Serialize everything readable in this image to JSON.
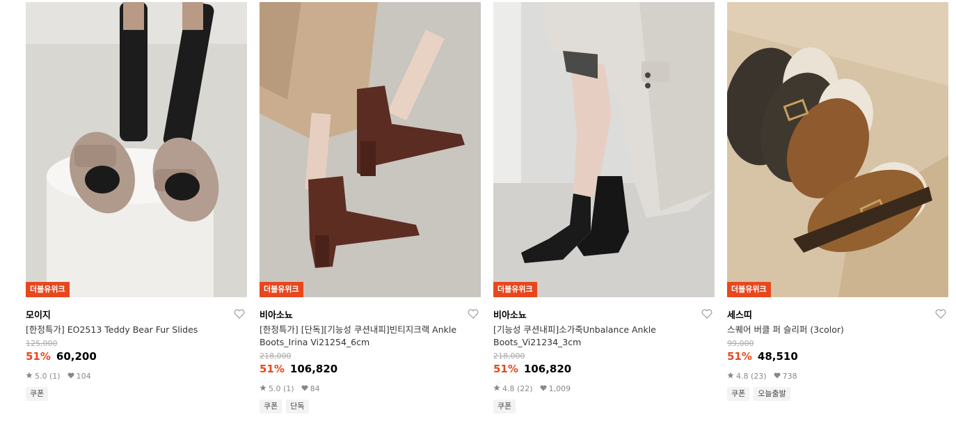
{
  "products": [
    {
      "badge": "더블유위크",
      "brand": "모이지",
      "title": "[한정특가] EO2513 Teddy Bear Fur Slides",
      "original_price": "125,000",
      "discount": "51%",
      "price": "60,200",
      "rating": "5.0 (1)",
      "likes": "104",
      "tags": [
        "쿠폰"
      ]
    },
    {
      "badge": "더블유위크",
      "brand": "비아소뇨",
      "title": "[한정특가] [단독][기능성 쿠션내피]빈티지크랙 Ankle Boots_Irina Vi21254_6cm",
      "original_price": "218,000",
      "discount": "51%",
      "price": "106,820",
      "rating": "5.0 (1)",
      "likes": "84",
      "tags": [
        "쿠폰",
        "단독"
      ]
    },
    {
      "badge": "더블유위크",
      "brand": "비아소뇨",
      "title": "[기능성 쿠션내피]소가죽Unbalance Ankle Boots_Vi21234_3cm",
      "original_price": "218,000",
      "discount": "51%",
      "price": "106,820",
      "rating": "4.8 (22)",
      "likes": "1,009",
      "tags": [
        "쿠폰"
      ]
    },
    {
      "badge": "더블유위크",
      "brand": "세스띠",
      "title": "스퀘어 버클 퍼 슬리퍼 (3color)",
      "original_price": "99,000",
      "discount": "51%",
      "price": "48,510",
      "rating": "4.8 (23)",
      "likes": "738",
      "tags": [
        "쿠폰",
        "오늘출발"
      ]
    }
  ],
  "colors": {
    "accent": "#e8471d",
    "tag_bg": "#f3f3f3",
    "muted": "#888888"
  }
}
